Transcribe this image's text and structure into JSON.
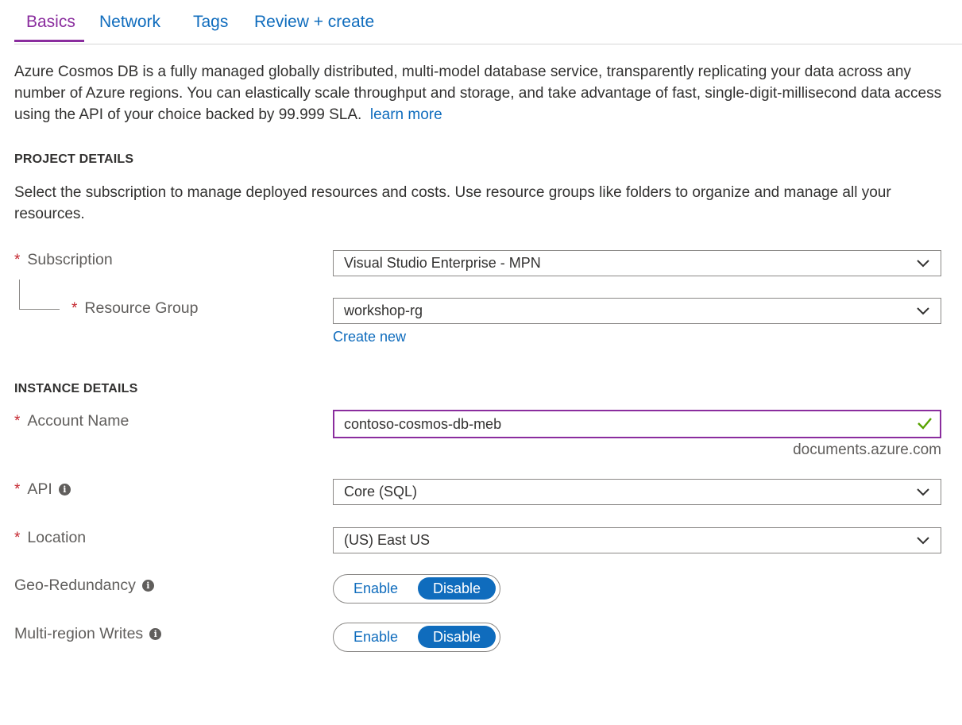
{
  "tabs": [
    {
      "label": "Basics"
    },
    {
      "label": "Network"
    },
    {
      "label": "Tags"
    },
    {
      "label": "Review + create"
    }
  ],
  "intro": {
    "text": "Azure Cosmos DB is a fully managed globally distributed, multi-model database service, transparently replicating your data across any number of Azure regions. You can elastically scale throughput and storage, and take advantage of fast, single-digit-millisecond data access using the API of your choice backed by 99.999 SLA.",
    "link": "learn more"
  },
  "project": {
    "title": "PROJECT DETAILS",
    "description": "Select the subscription to manage deployed resources and costs. Use resource groups like folders to organize and manage all your resources.",
    "subscription_label": "Subscription",
    "subscription_value": "Visual Studio Enterprise - MPN",
    "resource_group_label": "Resource Group",
    "resource_group_value": "workshop-rg",
    "create_new": "Create new"
  },
  "instance": {
    "title": "INSTANCE DETAILS",
    "account_name_label": "Account Name",
    "account_name_value": "contoso-cosmos-db-meb",
    "account_suffix": "documents.azure.com",
    "api_label": "API",
    "api_value": "Core (SQL)",
    "location_label": "Location",
    "location_value": "(US) East US",
    "geo_label": "Geo-Redundancy",
    "multi_label": "Multi-region Writes",
    "toggle_enable": "Enable",
    "toggle_disable": "Disable",
    "geo_selected": "Disable",
    "multi_selected": "Disable"
  },
  "colors": {
    "accent_purple": "#8a2d9e",
    "link_blue": "#0f6cbd",
    "required_red": "#c4262e",
    "valid_green": "#57a300"
  },
  "icons": {
    "required": "*",
    "info": "i"
  }
}
